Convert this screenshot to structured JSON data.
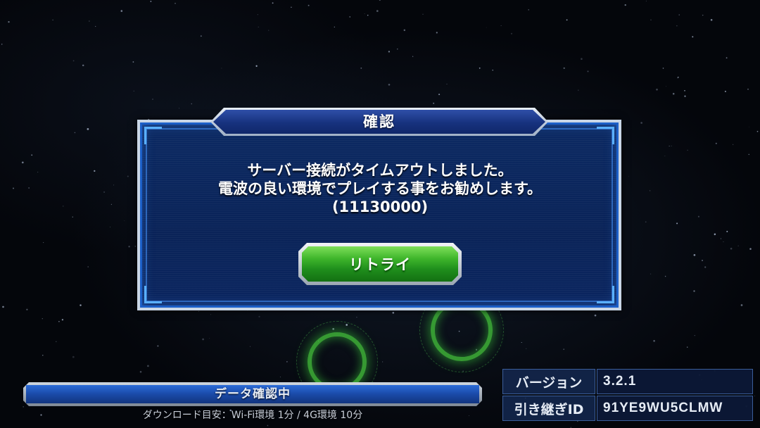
{
  "dialog": {
    "title": "確認",
    "message_lines": [
      "サーバー接続がタイムアウトしました。",
      "電波の良い環境でプレイする事をお勧めします。",
      "(11130000)"
    ],
    "retry_label": "リトライ"
  },
  "loading": {
    "label": "データ確認中",
    "progress": 1.0,
    "download_note": "ダウンロード目安：Wi-Fi環境 1分 / 4G環境 10分"
  },
  "info": {
    "version_label": "バージョン",
    "version_value": "3.2.1",
    "transfer_id_label": "引き継ぎID",
    "transfer_id_value": "91YE9WU5CLMW"
  },
  "colors": {
    "dialog_bg": "#0a2358",
    "retry_green": "#3eb52b",
    "ring_green": "#46c83c"
  }
}
